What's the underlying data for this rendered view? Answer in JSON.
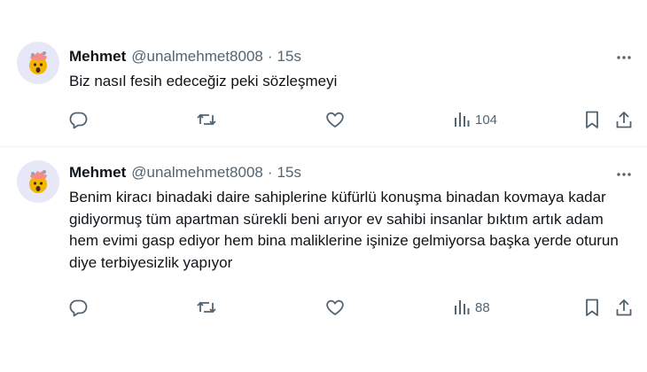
{
  "tweets": [
    {
      "author": {
        "name": "Mehmet",
        "handle": "@unalmehmet8008",
        "avatar_icon": "exploding-head-emoji-icon",
        "avatar_bg": "#e6e8f7"
      },
      "separator": "·",
      "time": "15s",
      "text": "Biz nasıl fesih edeceğiz peki sözleşmeyi",
      "actions": {
        "reply_icon": "reply-icon",
        "repost_icon": "repost-icon",
        "like_icon": "like-icon",
        "views_icon": "views-icon",
        "views_count": "104",
        "bookmark_icon": "bookmark-icon",
        "share_icon": "share-icon"
      }
    },
    {
      "author": {
        "name": "Mehmet",
        "handle": "@unalmehmet8008",
        "avatar_icon": "exploding-head-emoji-icon",
        "avatar_bg": "#e6e8f7"
      },
      "separator": "·",
      "time": "15s",
      "text": "Benim kiracı binadaki daire sahiplerine küfürlü konuşma binadan kovmaya kadar gidiyormuş tüm apartman sürekli beni arıyor ev sahibi insanlar bıktım artık adam hem evimi gasp ediyor hem bina maliklerine işinize gelmiyorsa başka yerde oturun diye terbiyesizlik yapıyor",
      "actions": {
        "reply_icon": "reply-icon",
        "repost_icon": "repost-icon",
        "like_icon": "like-icon",
        "views_icon": "views-icon",
        "views_count": "88",
        "bookmark_icon": "bookmark-icon",
        "share_icon": "share-icon"
      }
    }
  ],
  "colors": {
    "text_primary": "#0f1419",
    "text_secondary": "#536471",
    "divider": "#eff3f4",
    "background": "#ffffff"
  }
}
